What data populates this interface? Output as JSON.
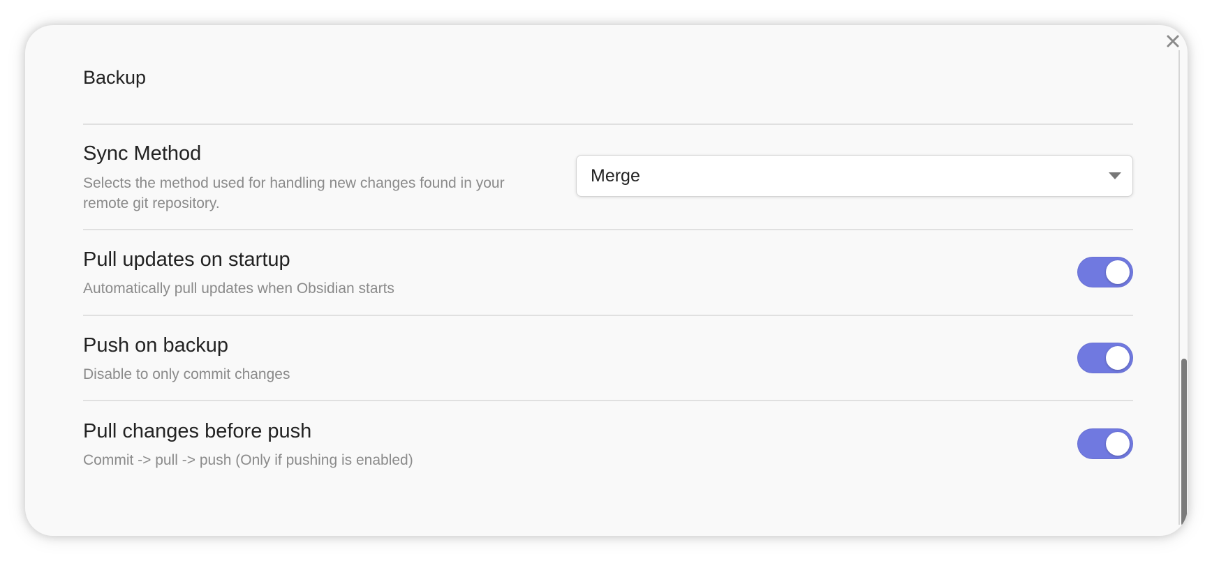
{
  "section": {
    "title": "Backup"
  },
  "settings": [
    {
      "name": "Sync Method",
      "description": "Selects the method used for handling new changes found in your remote git repository.",
      "control": "dropdown",
      "value": "Merge"
    },
    {
      "name": "Pull updates on startup",
      "description": "Automatically pull updates when Obsidian starts",
      "control": "toggle",
      "enabled": true
    },
    {
      "name": "Push on backup",
      "description": "Disable to only commit changes",
      "control": "toggle",
      "enabled": true
    },
    {
      "name": "Pull changes before push",
      "description": "Commit -> pull -> push (Only if pushing is enabled)",
      "control": "toggle",
      "enabled": true
    }
  ],
  "icons": {
    "close": "close-icon",
    "dropdown": "chevron-down-icon"
  },
  "colors": {
    "accent": "#7079e0",
    "background": "#f9f9f9",
    "text": "#222222",
    "muted_text": "#8a8a8a",
    "divider": "#e0e0e0"
  }
}
